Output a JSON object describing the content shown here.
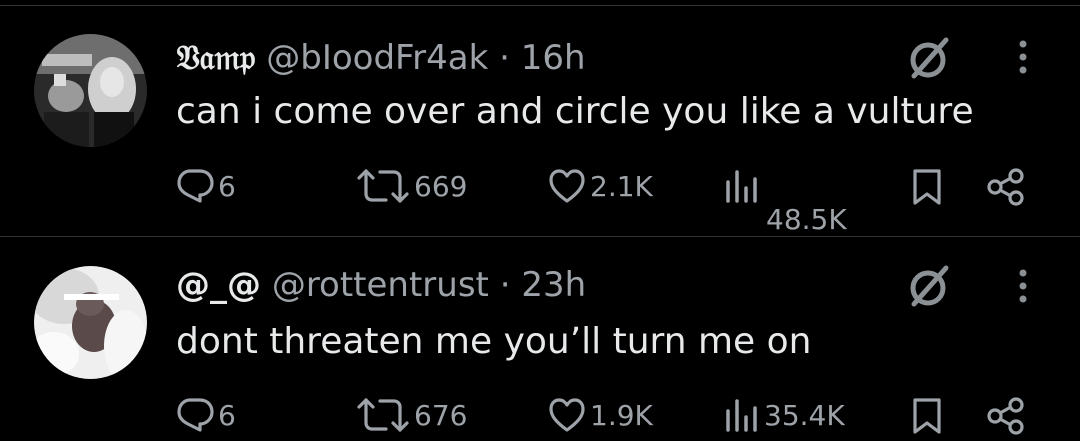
{
  "tweets": [
    {
      "display_name": "𝔙𝔞𝔪𝔭",
      "handle": "@bIoodFr4ak",
      "separator": "·",
      "time": "16h",
      "text": "can i come over and circle you like a vulture",
      "replies": "6",
      "reposts": "669",
      "likes": "2.1K",
      "views": "48.5K",
      "icons": [
        "grok-icon",
        "more-icon",
        "reply-icon",
        "repost-icon",
        "like-icon",
        "views-icon",
        "bookmark-icon",
        "share-icon"
      ]
    },
    {
      "display_name": "@_@",
      "handle": "@rottentrust",
      "separator": "·",
      "time": "23h",
      "text": "dont threaten me you’ll turn me on",
      "replies": "6",
      "reposts": "676",
      "likes": "1.9K",
      "views": "35.4K",
      "icons": [
        "grok-icon",
        "more-icon",
        "reply-icon",
        "repost-icon",
        "like-icon",
        "views-icon",
        "bookmark-icon",
        "share-icon"
      ]
    }
  ],
  "colors": {
    "background": "#000000",
    "text": "#e7e9ea",
    "muted": "#9da3a8",
    "divider": "#2f3336"
  }
}
